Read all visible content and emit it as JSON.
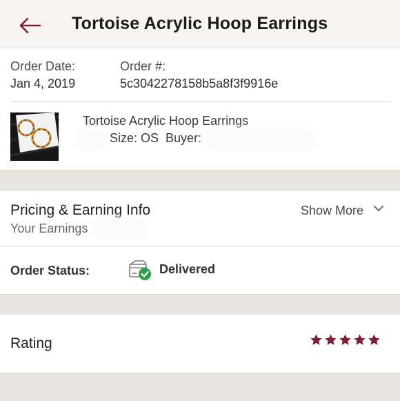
{
  "header": {
    "title": "Tortoise Acrylic Hoop Earrings",
    "back_icon": "arrow-left-icon"
  },
  "order": {
    "date_label": "Order Date:",
    "date_value": "Jan 4, 2019",
    "number_label": "Order #:",
    "number_value": "5c3042278158b5a8f3f9916e"
  },
  "item": {
    "name": "Tortoise Acrylic Hoop Earrings",
    "meta": "Size: OS  Buyer:"
  },
  "pricing": {
    "title": "Pricing & Earning Info",
    "earnings_label": "Your Earnings",
    "show_more": "Show More",
    "chevron_icon": "chevron-down-icon"
  },
  "status": {
    "label": "Order Status:",
    "value": "Delivered",
    "icon": "box-check-icon",
    "check_color": "#2e9e4a"
  },
  "rating": {
    "label": "Rating",
    "stars": 5,
    "max_stars": 5,
    "star_color": "#7d1e34"
  },
  "colors": {
    "accent": "#7d1e34",
    "band": "#e9e6df",
    "header_bg": "#f7f5f2"
  }
}
